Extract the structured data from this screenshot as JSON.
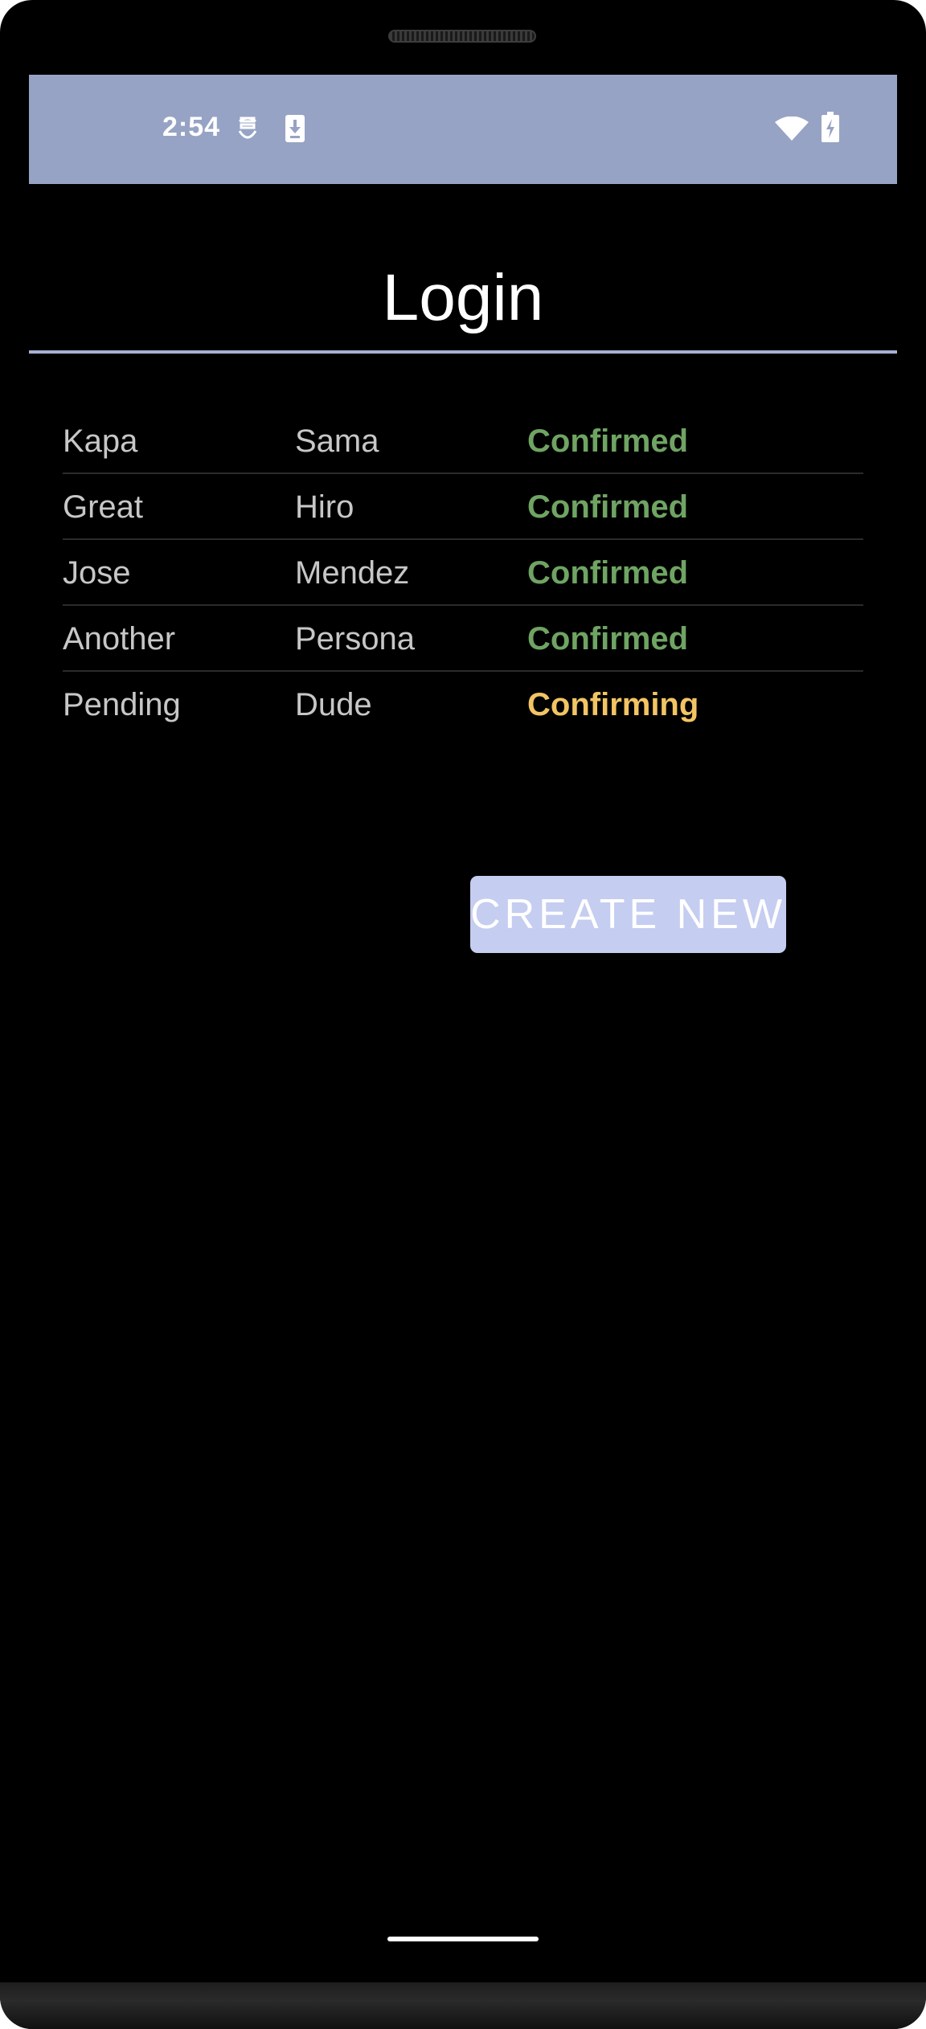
{
  "status_bar": {
    "time": "2:54",
    "icons": [
      "app-notification-icon",
      "download-icon",
      "wifi-icon",
      "battery-charging-icon"
    ]
  },
  "header": {
    "title": "Login"
  },
  "table": {
    "rows": [
      {
        "first": "Kapa",
        "last": "Sama",
        "status": "Confirmed"
      },
      {
        "first": "Great",
        "last": "Hiro",
        "status": "Confirmed"
      },
      {
        "first": "Jose",
        "last": "Mendez",
        "status": "Confirmed"
      },
      {
        "first": "Another",
        "last": "Persona",
        "status": "Confirmed"
      },
      {
        "first": "Pending",
        "last": "Dude",
        "status": "Confirming"
      }
    ]
  },
  "actions": {
    "create_new_label": "CREATE NEW"
  },
  "colors": {
    "status_bar_bg": "#97a3c4",
    "divider": "#a6b1d6",
    "confirmed": "#6fa463",
    "confirming": "#f2c464",
    "button_bg": "#c5cdf0"
  }
}
